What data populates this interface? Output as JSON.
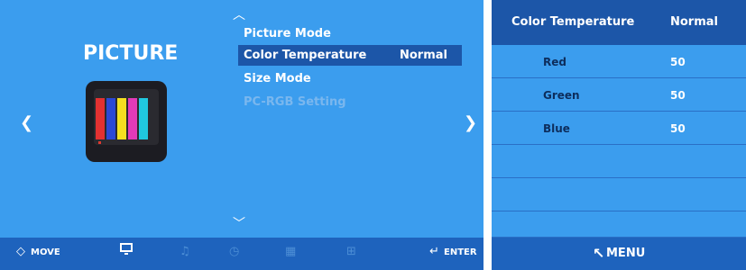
{
  "left": {
    "title": "PICTURE",
    "menu_items": [
      {
        "label": "Picture Mode",
        "value": ""
      },
      {
        "label": "Color Temperature",
        "value": "Normal"
      },
      {
        "label": "Size Mode",
        "value": ""
      },
      {
        "label": "PC-RGB Setting",
        "value": ""
      }
    ],
    "selected_index": 1,
    "disabled_index": 3,
    "left_arrow": "❮",
    "right_arrow": "❯",
    "up_chevron": "︿",
    "down_chevron": "﹀",
    "bottom_bar": {
      "move_icon": "◇",
      "move_label": "MOVE",
      "enter_icon": "↵",
      "enter_label": "ENTER",
      "category_icons": [
        "monitor-icon",
        "music-icon",
        "clock-icon",
        "grid-icon",
        "settings-grid-icon"
      ]
    },
    "tv_bar_colors": [
      "#e23131",
      "#2a48d6",
      "#f4df20",
      "#e23ab8",
      "#20c8df"
    ]
  },
  "right": {
    "header_title": "Color Temperature",
    "header_value": "Normal",
    "rows": [
      {
        "name": "Red",
        "value": "50"
      },
      {
        "name": "Green",
        "value": "50"
      },
      {
        "name": "Blue",
        "value": "50"
      },
      {
        "name": "",
        "value": ""
      },
      {
        "name": "",
        "value": ""
      },
      {
        "name": "",
        "value": ""
      }
    ],
    "footer_icon": "↖",
    "footer_label": "MENU"
  },
  "colors": {
    "panel_bg": "#3b9dee",
    "selected_bg": "#1c56a8",
    "bottom_bar_bg": "#1e63bd",
    "dim_text": "#7ab7ee",
    "row_label_text": "#0d2d5c"
  }
}
